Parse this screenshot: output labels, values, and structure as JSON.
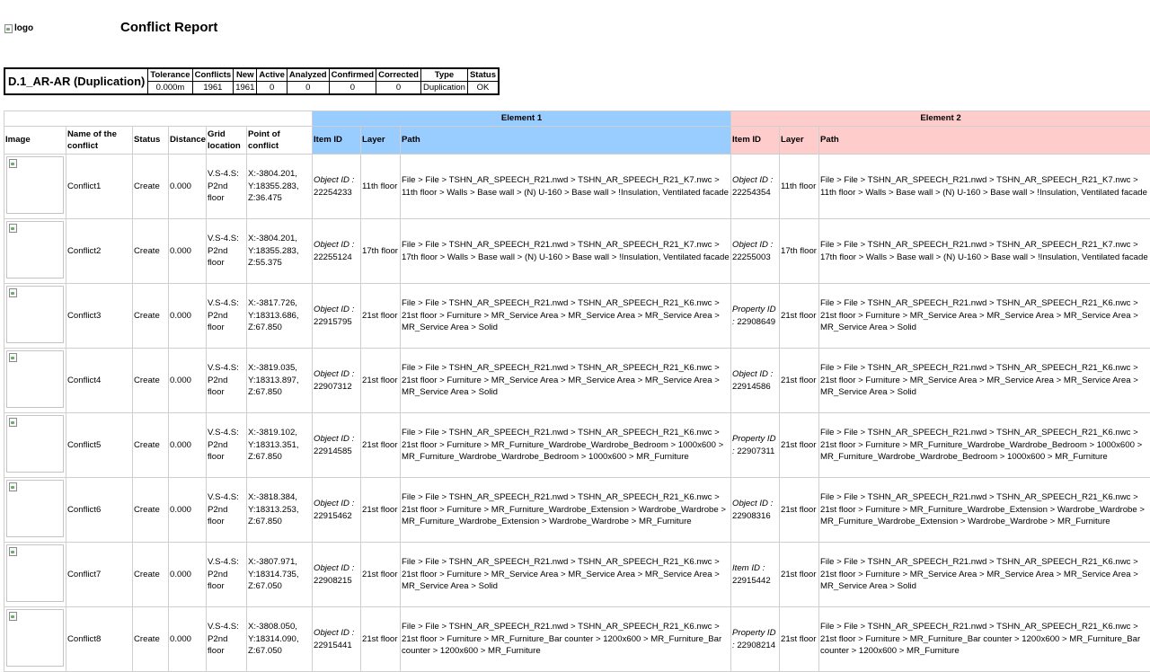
{
  "header": {
    "logo_alt": "logo",
    "title": "Conflict Report"
  },
  "summary": {
    "test_name": "D.1_AR-AR (Duplication)",
    "columns": [
      "Tolerance",
      "Conflicts",
      "New",
      "Active",
      "Analyzed",
      "Confirmed",
      "Corrected",
      "Type",
      "Status"
    ],
    "values": [
      "0.000m",
      "1961",
      "1961",
      "0",
      "0",
      "0",
      "0",
      "Duplication",
      "OK"
    ]
  },
  "table": {
    "element1_header": "Element 1",
    "element2_header": "Element 2",
    "columns": {
      "image": "Image",
      "name": "Name of the conflict",
      "status": "Status",
      "distance": "Distance",
      "grid": "Grid location",
      "point": "Point of conflict",
      "item_id": "Item ID",
      "layer": "Layer",
      "path": "Path"
    },
    "rows": [
      {
        "name": "Conflict1",
        "status": "Create",
        "distance": "0.000",
        "grid": "V.S-4.S: P2nd floor",
        "point": "X:-3804.201, Y:18355.283, Z:36.475",
        "e1_label": "Object ID :",
        "e1_id": "22254233",
        "e1_layer": "11th floor",
        "e1_path": "File > File > TSHN_AR_SPEECH_R21.nwd > TSHN_AR_SPEECH_R21_K7.nwc > 11th floor > Walls > Base wall > (N) U-160 > Base wall > !Insulation, Ventilated facade",
        "e2_label": "Object ID :",
        "e2_id": "22254354",
        "e2_layer": "11th floor",
        "e2_path": "File > File > TSHN_AR_SPEECH_R21.nwd > TSHN_AR_SPEECH_R21_K7.nwc > 11th floor > Walls > Base wall > (N) U-160 > Base wall > !Insulation, Ventilated facade"
      },
      {
        "name": "Conflict2",
        "status": "Create",
        "distance": "0.000",
        "grid": "V.S-4.S: P2nd floor",
        "point": "X:-3804.201, Y:18355.283, Z:55.375",
        "e1_label": "Object ID :",
        "e1_id": "22255124",
        "e1_layer": "17th floor",
        "e1_path": "File > File > TSHN_AR_SPEECH_R21.nwd > TSHN_AR_SPEECH_R21_K7.nwc > 17th floor > Walls > Base wall > (N) U-160 > Base wall > !Insulation, Ventilated facade",
        "e2_label": "Object ID :",
        "e2_id": "22255003",
        "e2_layer": "17th floor",
        "e2_path": "File > File > TSHN_AR_SPEECH_R21.nwd > TSHN_AR_SPEECH_R21_K7.nwc > 17th floor > Walls > Base wall > (N) U-160 > Base wall > !Insulation, Ventilated facade"
      },
      {
        "name": "Conflict3",
        "status": "Create",
        "distance": "0.000",
        "grid": "V.S-4.S: P2nd floor",
        "point": "X:-3817.726, Y:18313.686, Z:67.850",
        "e1_label": "Object ID :",
        "e1_id": "22915795",
        "e1_layer": "21st floor",
        "e1_path": "File > File > TSHN_AR_SPEECH_R21.nwd > TSHN_AR_SPEECH_R21_K6.nwc > 21st floor > Furniture > MR_Service Area > MR_Service Area > MR_Service Area > MR_Service Area > Solid",
        "e2_label": "Property ID :",
        "e2_id": "22908649",
        "e2_layer": "21st floor",
        "e2_path": "File > File > TSHN_AR_SPEECH_R21.nwd > TSHN_AR_SPEECH_R21_K6.nwc > 21st floor > Furniture > MR_Service Area > MR_Service Area > MR_Service Area > MR_Service Area > Solid"
      },
      {
        "name": "Conflict4",
        "status": "Create",
        "distance": "0.000",
        "grid": "V.S-4.S: P2nd floor",
        "point": "X:-3819.035, Y:18313.897, Z:67.850",
        "e1_label": "Object ID :",
        "e1_id": "22907312",
        "e1_layer": "21st floor",
        "e1_path": "File > File > TSHN_AR_SPEECH_R21.nwd > TSHN_AR_SPEECH_R21_K6.nwc > 21st floor > Furniture > MR_Service Area > MR_Service Area > MR_Service Area > MR_Service Area > Solid",
        "e2_label": "Object ID :",
        "e2_id": "22914586",
        "e2_layer": "21st floor",
        "e2_path": "File > File > TSHN_AR_SPEECH_R21.nwd > TSHN_AR_SPEECH_R21_K6.nwc > 21st floor > Furniture > MR_Service Area > MR_Service Area > MR_Service Area > MR_Service Area > Solid"
      },
      {
        "name": "Conflict5",
        "status": "Create",
        "distance": "0.000",
        "grid": "V.S-4.S: P2nd floor",
        "point": "X:-3819.102, Y:18313.351, Z:67.850",
        "e1_label": "Object ID :",
        "e1_id": "22914585",
        "e1_layer": "21st floor",
        "e1_path": "File > File > TSHN_AR_SPEECH_R21.nwd > TSHN_AR_SPEECH_R21_K6.nwc > 21st floor > Furniture > MR_Furniture_Wardrobe_Wardrobe_Bedroom > 1000x600 > MR_Furniture_Wardrobe_Wardrobe_Bedroom > 1000x600 > MR_Furniture",
        "e2_label": "Property ID :",
        "e2_id": "22907311",
        "e2_layer": "21st floor",
        "e2_path": "File > File > TSHN_AR_SPEECH_R21.nwd > TSHN_AR_SPEECH_R21_K6.nwc > 21st floor > Furniture > MR_Furniture_Wardrobe_Wardrobe_Bedroom > 1000x600 > MR_Furniture_Wardrobe_Wardrobe_Bedroom > 1000x600 > MR_Furniture"
      },
      {
        "name": "Conflict6",
        "status": "Create",
        "distance": "0.000",
        "grid": "V.S-4.S: P2nd floor",
        "point": "X:-3818.384, Y:18313.253, Z:67.850",
        "e1_label": "Object ID :",
        "e1_id": "22915462",
        "e1_layer": "21st floor",
        "e1_path": "File > File > TSHN_AR_SPEECH_R21.nwd > TSHN_AR_SPEECH_R21_K6.nwc > 21st floor > Furniture > MR_Furniture_Wardrobe_Extension > Wardrobe_Wardrobe > MR_Furniture_Wardrobe_Extension > Wardrobe_Wardrobe > MR_Furniture",
        "e2_label": "Object ID :",
        "e2_id": "22908316",
        "e2_layer": "21st floor",
        "e2_path": "File > File > TSHN_AR_SPEECH_R21.nwd > TSHN_AR_SPEECH_R21_K6.nwc > 21st floor > Furniture > MR_Furniture_Wardrobe_Extension > Wardrobe_Wardrobe > MR_Furniture_Wardrobe_Extension > Wardrobe_Wardrobe > MR_Furniture"
      },
      {
        "name": "Conflict7",
        "status": "Create",
        "distance": "0.000",
        "grid": "V.S-4.S: P2nd floor",
        "point": "X:-3807.971, Y:18314.735, Z:67.050",
        "e1_label": "Object ID :",
        "e1_id": "22908215",
        "e1_layer": "21st floor",
        "e1_path": "File > File > TSHN_AR_SPEECH_R21.nwd > TSHN_AR_SPEECH_R21_K6.nwc > 21st floor > Furniture > MR_Service Area > MR_Service Area > MR_Service Area > MR_Service Area > Solid",
        "e2_label": "Item ID :",
        "e2_id": "22915442",
        "e2_layer": "21st floor",
        "e2_path": "File > File > TSHN_AR_SPEECH_R21.nwd > TSHN_AR_SPEECH_R21_K6.nwc > 21st floor > Furniture > MR_Service Area > MR_Service Area > MR_Service Area > MR_Service Area > Solid"
      },
      {
        "name": "Conflict8",
        "status": "Create",
        "distance": "0.000",
        "grid": "V.S-4.S: P2nd floor",
        "point": "X:-3808.050, Y:18314.090, Z:67.050",
        "e1_label": "Object ID :",
        "e1_id": "22915441",
        "e1_layer": "21st floor",
        "e1_path": "File > File > TSHN_AR_SPEECH_R21.nwd > TSHN_AR_SPEECH_R21_K6.nwc > 21st floor > Furniture > MR_Furniture_Bar counter > 1200x600 > MR_Furniture_Bar counter > 1200x600 > MR_Furniture",
        "e2_label": "Property ID :",
        "e2_id": "22908214",
        "e2_layer": "21st floor",
        "e2_path": "File > File > TSHN_AR_SPEECH_R21.nwd > TSHN_AR_SPEECH_R21_K6.nwc > 21st floor > Furniture > MR_Furniture_Bar counter > 1200x600 > MR_Furniture_Bar counter > 1200x600 > MR_Furniture"
      }
    ]
  },
  "colors": {
    "element1_bg": "#99ccff",
    "element2_bg": "#ffcccc"
  }
}
